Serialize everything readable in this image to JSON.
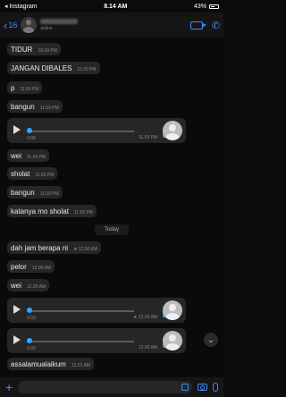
{
  "status_bar": {
    "carrier": "◂ Instagram",
    "time": "8.14 AM",
    "battery": "43%"
  },
  "header": {
    "back_label": "16",
    "contact_sub": "online"
  },
  "messages_before": [
    {
      "text": "TIDUR",
      "time": "10.59 PM"
    },
    {
      "text": "JANGAN DIBALES",
      "time": "11.00 PM"
    },
    {
      "text": "p",
      "time": "11.59 PM"
    },
    {
      "text": "bangun",
      "time": "11.59 PM"
    }
  ],
  "voice_1": {
    "duration": "0:08",
    "time": "11.59 PM"
  },
  "messages_mid": [
    {
      "text": "wei",
      "time": "11.59 PM"
    },
    {
      "text": "sholat",
      "time": "11.59 PM"
    },
    {
      "text": "bangun",
      "time": "11.59 PM"
    },
    {
      "text": "katanya mo sholat",
      "time": "11.59 PM"
    }
  ],
  "day_divider": "Today",
  "messages_today": [
    {
      "text": "dah jam berapa ni",
      "time": "★ 12.00 AM"
    },
    {
      "text": "pelor",
      "time": "12.00 AM"
    },
    {
      "text": "wei",
      "time": "12.00 AM"
    }
  ],
  "voice_2": {
    "duration": "0:03",
    "time": "★ 12.00 AM"
  },
  "voice_3": {
    "duration": "0:09",
    "time": "12.00 AM"
  },
  "last_message": {
    "text": "assalamualaikum",
    "time": "12.01 AM"
  },
  "icons": {
    "scroll_down": "⌄",
    "plus": "+",
    "call": "✆"
  }
}
